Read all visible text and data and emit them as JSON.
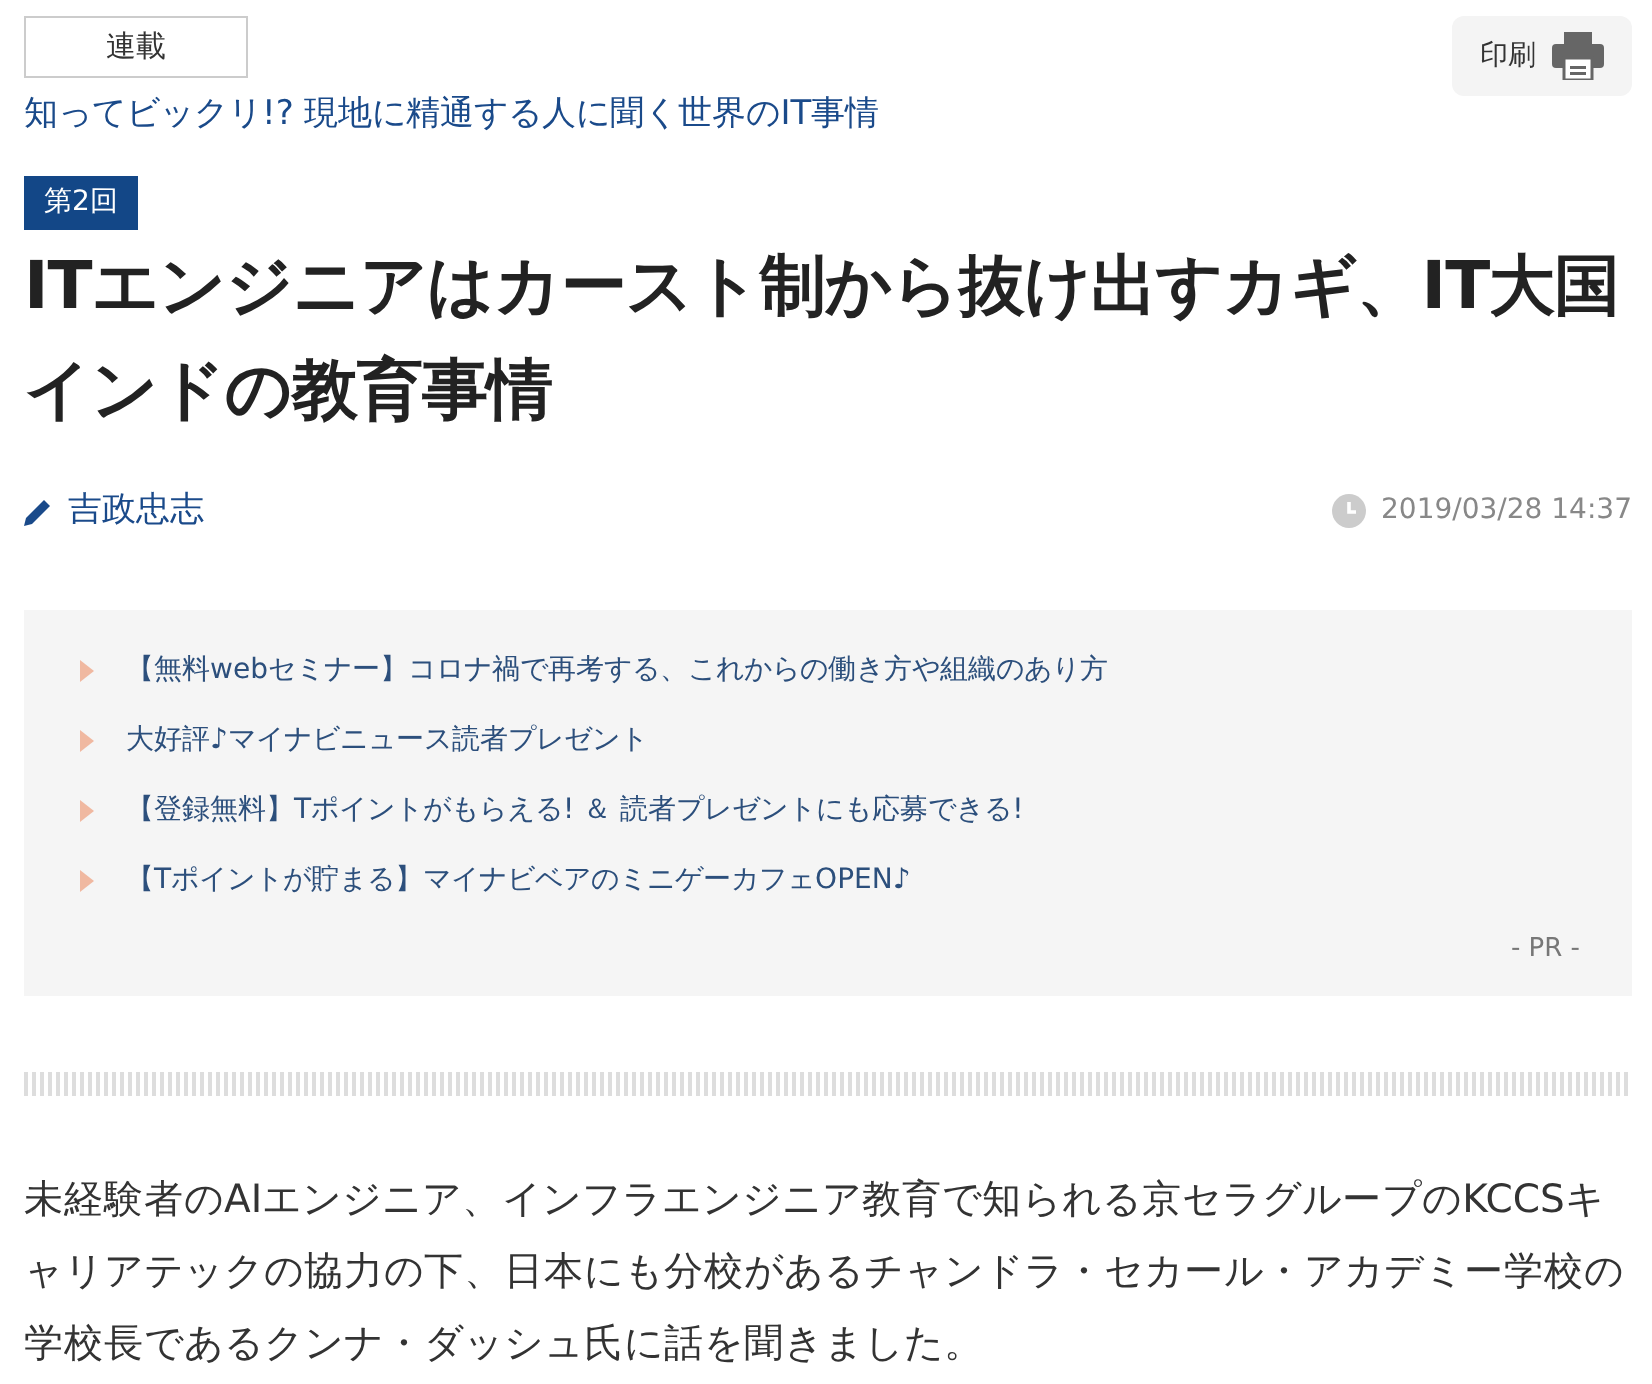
{
  "series_tag": "連載",
  "print_button": {
    "label": "印刷"
  },
  "series_title": "知ってビックリ!? 現地に精通する人に聞く世界のIT事情",
  "episode_badge": "第2回",
  "title": "ITエンジニアはカースト制から抜け出すカギ、IT大国インドの教育事情",
  "author": "吉政忠志",
  "timestamp": "2019/03/28 14:37",
  "pr_links": [
    "【無料webセミナー】コロナ禍で再考する、これからの働き方や組織のあり方",
    "大好評♪マイナビニュース読者プレゼント",
    "【登録無料】Tポイントがもらえる! ＆ 読者プレゼントにも応募できる!",
    "【Tポイントが貯まる】マイナビベアのミニゲーカフェOPEN♪"
  ],
  "pr_label": "- PR -",
  "body": "未経験者のAIエンジニア、インフラエンジニア教育で知られる京セラグループのKCCSキャリアテックの協力の下、日本にも分校があるチャンドラ・セカール・アカデミー学校の学校長であるクンナ・ダッシュ氏に話を聞きました。"
}
